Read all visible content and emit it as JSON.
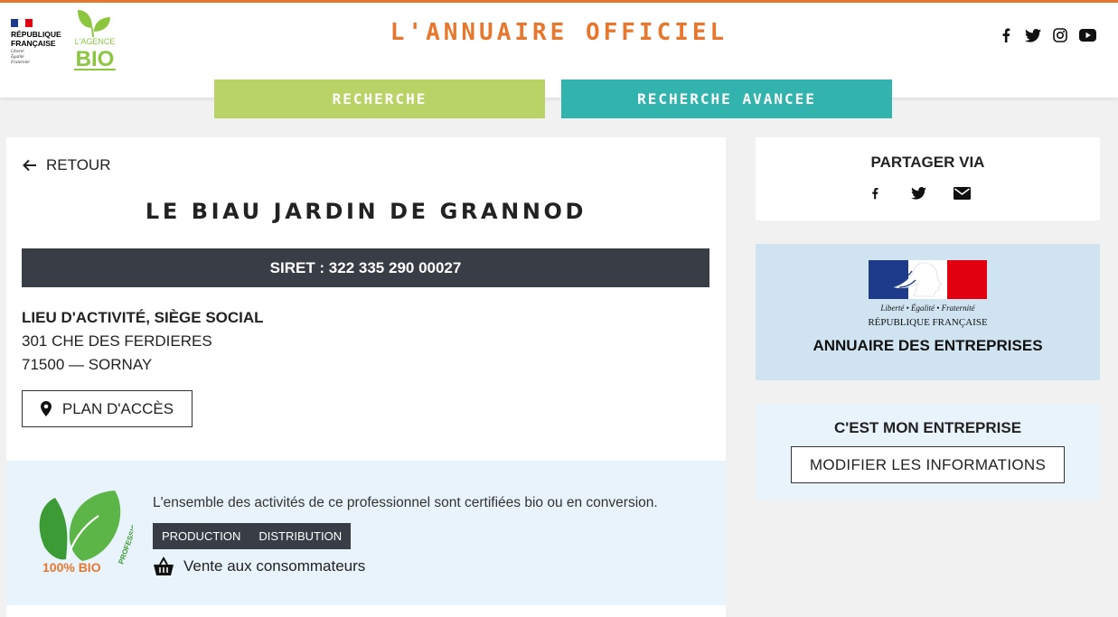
{
  "header": {
    "rf_logo": {
      "title_line1": "RÉPUBLIQUE",
      "title_line2": "FRANÇAISE",
      "motto": [
        "Liberté",
        "Égalité",
        "Fraternité"
      ]
    },
    "agency_logo": {
      "text_top": "L'AGENCE",
      "text_main": "BIO"
    },
    "site_title": "L'ANNUAIRE OFFICIEL",
    "social_icons": [
      "facebook-icon",
      "twitter-icon",
      "instagram-icon",
      "youtube-icon"
    ]
  },
  "nav": {
    "search_label": "RECHERCHE",
    "advanced_label": "RECHERCHE AVANCEE",
    "colors": {
      "search": "#b9d366",
      "advanced": "#32b3ad",
      "accent": "#e8772e"
    }
  },
  "main": {
    "back_label": "RETOUR",
    "company_name": "LE BIAU JARDIN DE GRANNOD",
    "siret": "SIRET : 322 335 290 00027",
    "address": {
      "label": "LIEU D'ACTIVITÉ, SIÈGE SOCIAL",
      "street": "301 CHE DES FERDIERES",
      "city": "71500 — SORNAY"
    },
    "map_button_label": "PLAN D'ACCÈS"
  },
  "bio": {
    "badge_text": "100% BIO",
    "badge_subtext": "PROFESSIONNEL",
    "certification_text": "L'ensemble des activités de ce professionnel sont certifiées bio ou en conversion.",
    "activities": [
      "PRODUCTION",
      "DISTRIBUTION"
    ],
    "sales_label": "Vente aux consommateurs"
  },
  "sidebar": {
    "share_title": "PARTAGER VIA",
    "share_icons": [
      "facebook-icon",
      "twitter-icon",
      "mail-icon"
    ],
    "annuaire": {
      "motto": "Liberté • Égalité • Fraternité",
      "republic": "RÉPUBLIQUE FRANÇAISE",
      "label": "ANNUAIRE DES ENTREPRISES"
    },
    "my_company": {
      "title": "C'EST MON ENTREPRISE",
      "button_label": "MODIFIER LES INFORMATIONS"
    }
  }
}
